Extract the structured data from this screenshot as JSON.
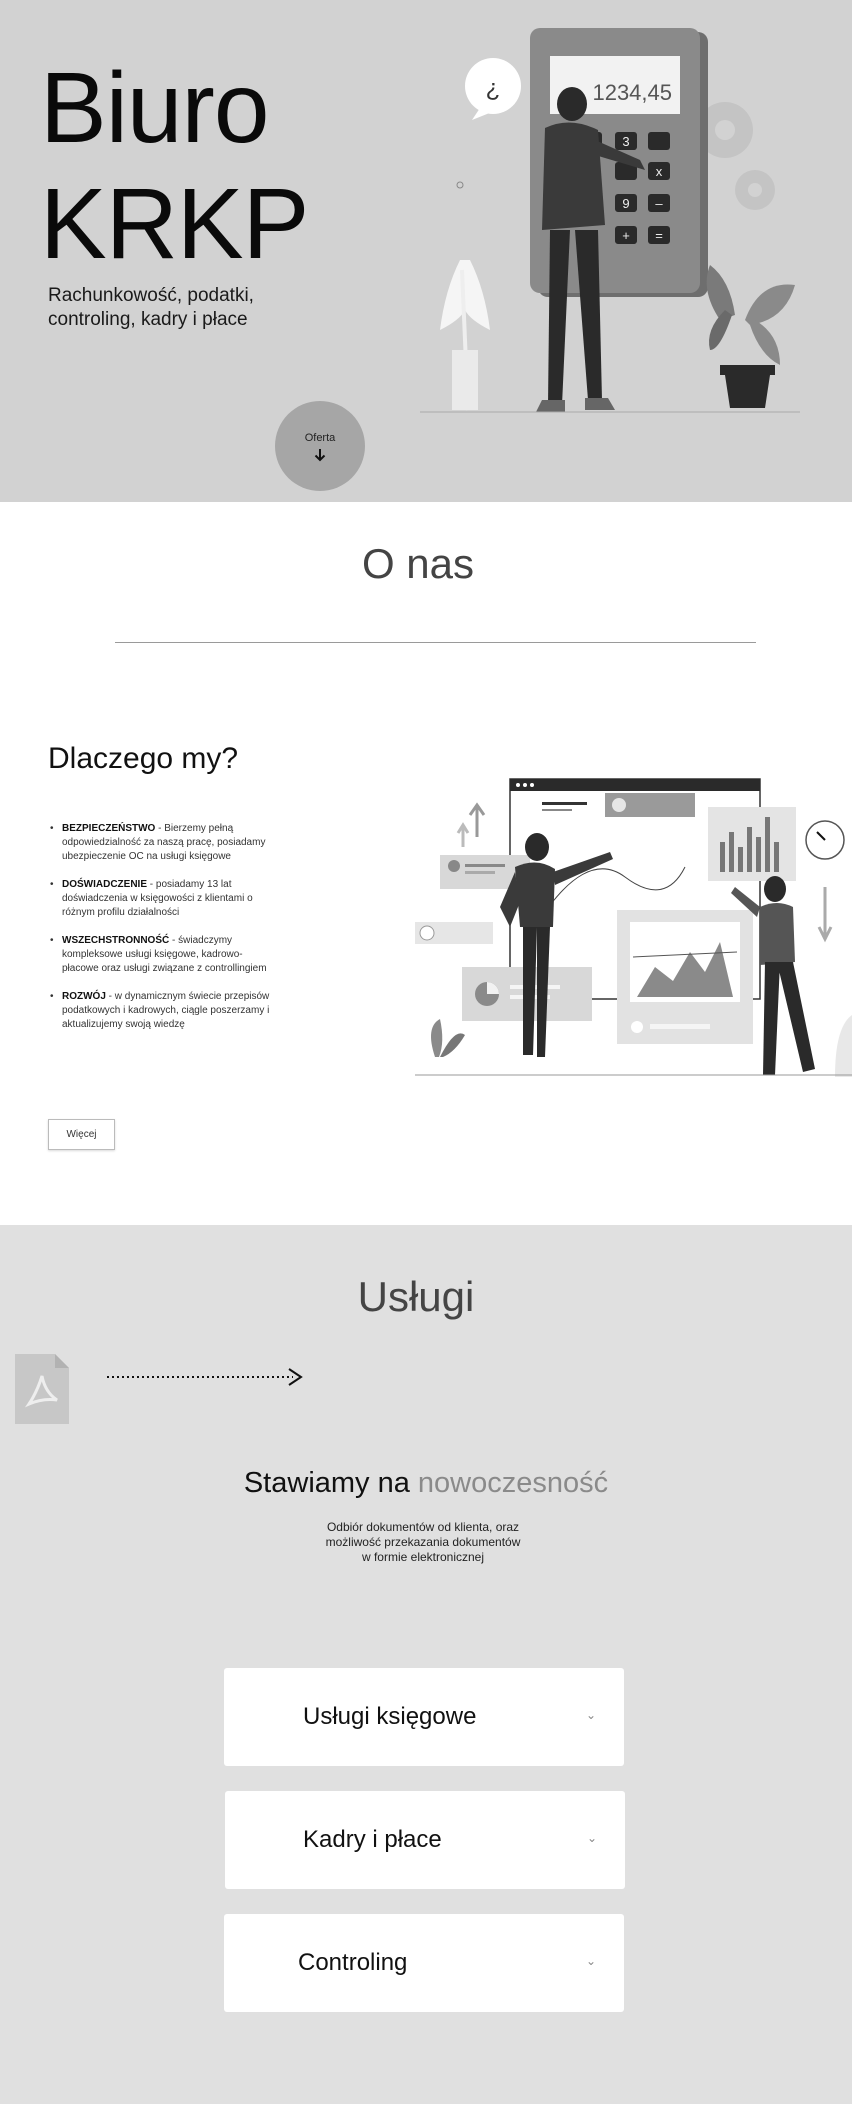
{
  "hero": {
    "title_line1": "Biuro",
    "title_line2": "KRKP",
    "subtitle_line1": "Rachunkowość, podatki,",
    "subtitle_line2": "controling, kadry i płace",
    "offer_label": "Oferta",
    "offer_icon": "arrow-down-icon",
    "calculator_display": "1234,45",
    "speech_glyph": "¿",
    "calculator_keys": [
      "3",
      "x",
      "9",
      "–",
      "+",
      "="
    ]
  },
  "about": {
    "title": "O nas",
    "why_title": "Dlaczego my?",
    "reasons": [
      {
        "title": "BEZPIECZEŃSTWO",
        "text": " - Bierzemy pełną odpowiedzialność za naszą pracę, posiadamy ubezpieczenie OC na usługi księgowe"
      },
      {
        "title": "DOŚWIADCZENIE",
        "text": " - posiadamy 13 lat doświadczenia w księgowości z klientami o różnym profilu działalności"
      },
      {
        "title": "WSZECHSTRONNOŚĆ",
        "text": " - świadczymy kompleksowe usługi księgowe, kadrowo-płacowe oraz usługi związane z controllingiem"
      },
      {
        "title": "ROZWÓJ",
        "text": " - w dynamicznym świecie przepisów podatkowych i kadrowych, ciągle poszerzamy i aktualizujemy swoją wiedzę"
      }
    ],
    "more_label": "Więcej"
  },
  "services": {
    "title": "Usługi",
    "headline_plain": "Stawiamy na ",
    "headline_muted": "nowoczesność",
    "desc_line1": "Odbiór dokumentów od klienta, oraz",
    "desc_line2": "możliwość przekazania dokumentów",
    "desc_line3": "w formie elektronicznej",
    "items": [
      {
        "label": "Usługi księgowe"
      },
      {
        "label": "Kadry i płace"
      },
      {
        "label": "Controling"
      }
    ],
    "chevron": "⌄"
  },
  "colors": {
    "hero_bg": "#d2d2d2",
    "services_bg": "#e0e0e0",
    "offer_button": "#a6a6a6",
    "muted_text": "#8a8a8a"
  }
}
